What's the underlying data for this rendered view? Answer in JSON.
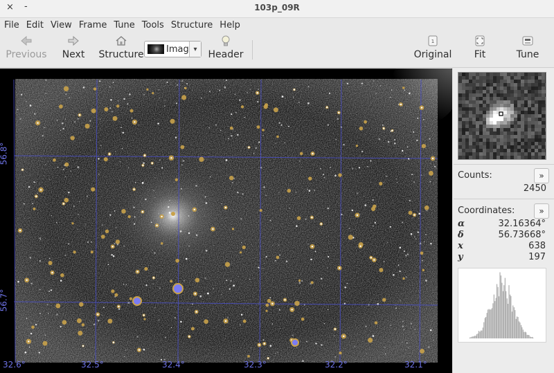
{
  "window": {
    "title": "103p_09R",
    "close_glyph": "×",
    "min_glyph": "-"
  },
  "menu": [
    "File",
    "Edit",
    "View",
    "Frame",
    "Tune",
    "Tools",
    "Structure",
    "Help"
  ],
  "toolbar": {
    "previous": "Previous",
    "next": "Next",
    "structure": "Structure",
    "image_select": "Image",
    "header": "Header",
    "original": "Original",
    "fit": "Fit",
    "tune": "Tune"
  },
  "image": {
    "ra_labels": [
      "32.6°",
      "32.5°",
      "32.4°",
      "32.3°",
      "32.2°",
      "32.1°"
    ],
    "dec_labels": [
      "56.8°",
      "56.7°"
    ]
  },
  "side": {
    "counts_label": "Counts:",
    "counts_value": "2450",
    "coords_label": "Coordinates:",
    "expand_glyph": "»",
    "coords": [
      {
        "sym": "α",
        "value": "32.16364°"
      },
      {
        "sym": "δ",
        "value": "56.73668°"
      },
      {
        "sym": "x",
        "value": "638"
      },
      {
        "sym": "y",
        "value": "197"
      }
    ]
  },
  "colors": {
    "grid": "#4a4fc8",
    "star_marker": "#c9a24a",
    "selected_marker": "#7b7cf2"
  }
}
